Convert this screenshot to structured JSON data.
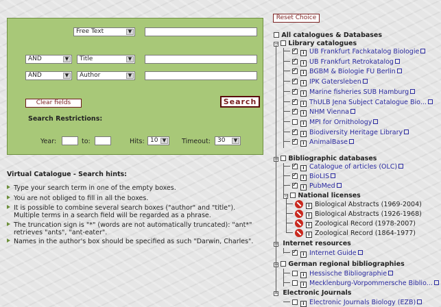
{
  "reset_label": "Reset Choice",
  "form": {
    "row1": {
      "field": "Free Text",
      "value": ""
    },
    "row2": {
      "op": "AND",
      "field": "Title",
      "value": ""
    },
    "row3": {
      "op": "AND",
      "field": "Author",
      "value": ""
    },
    "clear_label": "Clear fields",
    "search_label": "Search",
    "restrictions_label": "Search Restrictions:",
    "year_label": "Year:",
    "to_label": "to:",
    "hits_label": "Hits:",
    "hits_value": "10",
    "timeout_label": "Timeout:",
    "timeout_value": "30"
  },
  "hints": {
    "title": "Virtual Catalogue - Search hints:",
    "items": [
      "Type your search term in one of the empty boxes.",
      "You are not obliged to fill in all the boxes.",
      "It is possible to combine several search boxes (\"author\" and \"title\"). Multiple terms in a search field will be regarded as a phrase.",
      "The truncation sign is \"*\" (words are not automatically truncated): \"ant*\" retrieves \"ants\", \"ant-eater\".",
      "Names in the author's box should be specified as such \"Darwin, Charles\"."
    ]
  },
  "tree": {
    "root": "All catalogues & Databases",
    "library": {
      "label": "Library catalogues",
      "items": [
        {
          "label": "UB Frankfurt Fachkatalog Biologie",
          "checked": true
        },
        {
          "label": "UB Frankfurt Retrokatalog",
          "checked": true
        },
        {
          "label": "BGBM & Biologie FU Berlin",
          "checked": true
        },
        {
          "label": "IPK Gatersleben",
          "checked": true
        },
        {
          "label": "Marine fisheries SUB Hamburg",
          "checked": true
        },
        {
          "label": "ThULB Jena Subject Catalogue Bio...",
          "checked": true
        },
        {
          "label": "NHM Vienna",
          "checked": true
        },
        {
          "label": "MPI for Ornithology",
          "checked": false
        },
        {
          "label": "Biodiversity Heritage Library",
          "checked": true
        },
        {
          "label": "AnimalBase",
          "checked": true
        }
      ]
    },
    "biblio": {
      "label": "Bibliographic databases",
      "items": [
        {
          "label": "Catalogue of articles (OLC)",
          "checked": true
        },
        {
          "label": "BioLIS",
          "checked": true
        },
        {
          "label": "PubMed",
          "checked": true
        }
      ]
    },
    "national": {
      "label": "National licenses",
      "items": [
        "Biological Abstracts (1969-2004)",
        "Biological Abstracts (1926-1968)",
        "Zoological Record (1978-2007)",
        "Zoological Record (1864-1977)"
      ]
    },
    "internet": {
      "label": "Internet resources",
      "items": [
        {
          "label": "Internet Guide",
          "checked": true
        }
      ]
    },
    "regional": {
      "label": "German regional bibliographies",
      "items": [
        {
          "label": "Hessische Bibliographie",
          "checked": false
        },
        {
          "label": "Mecklenburg-Vorpommersche Biblio...",
          "checked": false
        }
      ]
    },
    "ejournals": {
      "label": "Electronic Journals",
      "items": [
        {
          "label": "Electronic Journals Biology (EZB)",
          "checked": false
        }
      ]
    }
  }
}
